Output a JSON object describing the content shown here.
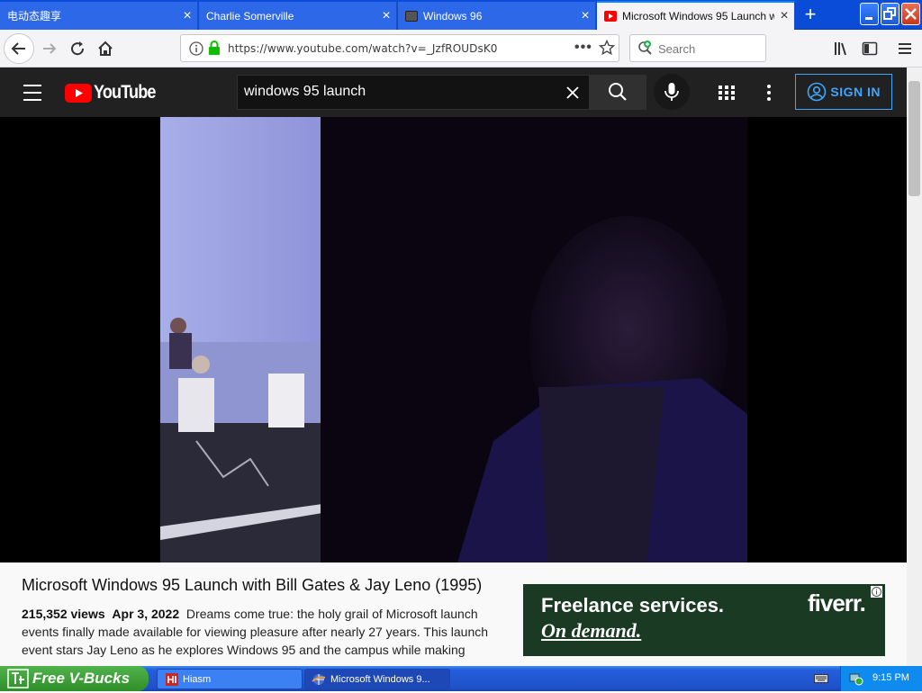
{
  "browser": {
    "tabs": [
      {
        "title": "电动态趣享",
        "active": false
      },
      {
        "title": "Charlie Somerville",
        "active": false
      },
      {
        "title": "Windows 96",
        "active": false
      },
      {
        "title": "Microsoft Windows 95 Launch wit",
        "active": true
      }
    ],
    "tab_close_glyph": "×",
    "url": "https://www.youtube.com/watch?v=_JzfROUDsK0",
    "search_placeholder": "Search"
  },
  "youtube": {
    "logo_text": "YouTube",
    "search_value": "windows 95 launch",
    "sign_in_label": "SIGN IN"
  },
  "video": {
    "title": "Microsoft Windows 95 Launch with Bill Gates & Jay Leno (1995)",
    "views": "215,352 views",
    "date": "Apr 3, 2022",
    "description": "Dreams come true: the holy grail of Microsoft launch events finally made available for viewing pleasure after nearly 27 years. This launch event stars Jay Leno as he explores Windows 95 and the campus while making"
  },
  "ad": {
    "line1": "Freelance services.",
    "line2": "On demand.",
    "brand": "fiverr."
  },
  "taskbar": {
    "start_label": "Free V-Bucks",
    "items": [
      {
        "label": "Hiasm",
        "active": false
      },
      {
        "label": "Microsoft Windows 9...",
        "active": true
      }
    ],
    "clock": "9:15 PM"
  },
  "colors": {
    "youtube_red": "#ff0000",
    "youtube_header": "#212121",
    "link_blue": "#3ea6ff",
    "fiverr_green": "#1dbf73",
    "xp_blue": "#245edb"
  }
}
